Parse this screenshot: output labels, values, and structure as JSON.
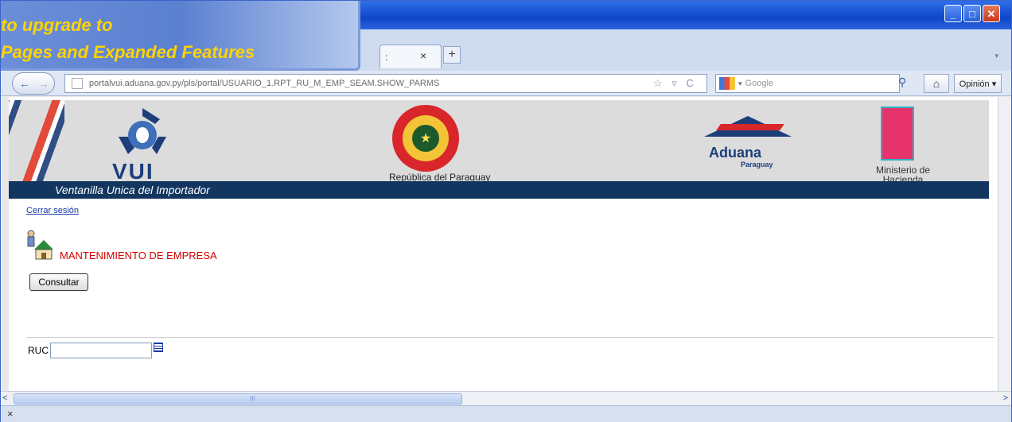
{
  "banner": {
    "line1": "to upgrade to",
    "line2": "Pages and Expanded Features"
  },
  "window": {
    "buttons": {
      "minimize": "_",
      "maximize": "□",
      "close": "✕"
    }
  },
  "tabs": {
    "active_partial": ":",
    "close": "×",
    "add": "+",
    "list": "▾"
  },
  "nav": {
    "back": "←",
    "forward": "→",
    "url": "portalvui.aduana.gov.py/pls/portal/USUARIO_1.RPT_RU_M_EMP_SEAM.SHOW_PARMS",
    "url_controls": "☆ ▿ C",
    "search_engine": "▾",
    "search_placeholder": "Google",
    "home": "⌂",
    "opinion": "Opinión ▾"
  },
  "header": {
    "vui_logo_text": "VUI",
    "bar_text": "Ventanilla Unica del Importador",
    "republic_label": "República del Paraguay",
    "aduana_name": "Aduana",
    "aduana_sub": "Paraguay",
    "ministry_label": "Ministerio de Hacienda"
  },
  "page": {
    "logout": "Cerrar sesión",
    "section_title": "MANTENIMIENTO DE EMPRESA",
    "consultar_button": "Consultar",
    "ruc_label": "RUC",
    "ruc_value": ""
  },
  "scroll": {
    "left": "<",
    "right": ">",
    "grip": "III"
  },
  "status": {
    "close_x": "×"
  }
}
